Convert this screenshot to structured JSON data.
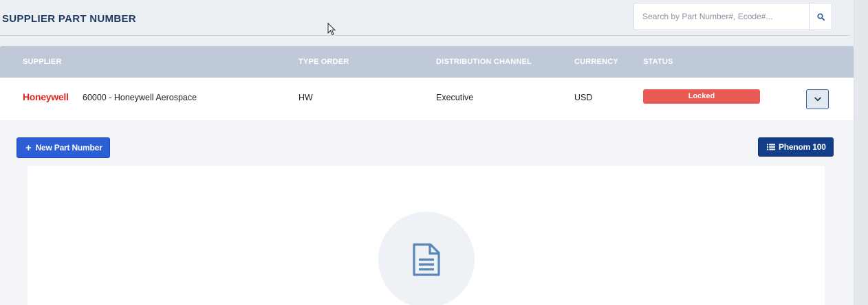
{
  "header": {
    "title": "SUPPLIER PART NUMBER",
    "search_placeholder": "Search by Part Number#, Ecode#...",
    "search_icon": "search-icon"
  },
  "table": {
    "columns": [
      "SUPPLIER",
      "TYPE ORDER",
      "DISTRIBUTION CHANNEL",
      "CURRENCY",
      "STATUS"
    ],
    "rows": [
      {
        "brand": "Honeywell",
        "supplier": "60000 - Honeywell Aerospace",
        "type_order": "HW",
        "distribution_channel": "Executive",
        "currency": "USD",
        "status": "Locked",
        "expand_icon": "chevron-down-icon"
      }
    ]
  },
  "actions": {
    "new_part_label": "New Part Number",
    "aircraft_label": "Phenom 100"
  },
  "empty_state": {
    "icon": "document-icon"
  },
  "colors": {
    "brand_red": "#e0291e",
    "status_locked": "#e85a53",
    "primary_button": "#2c5fd6",
    "dark_button": "#133e8a",
    "table_header": "#bfc9d8",
    "title_text": "#1f3a5c"
  }
}
